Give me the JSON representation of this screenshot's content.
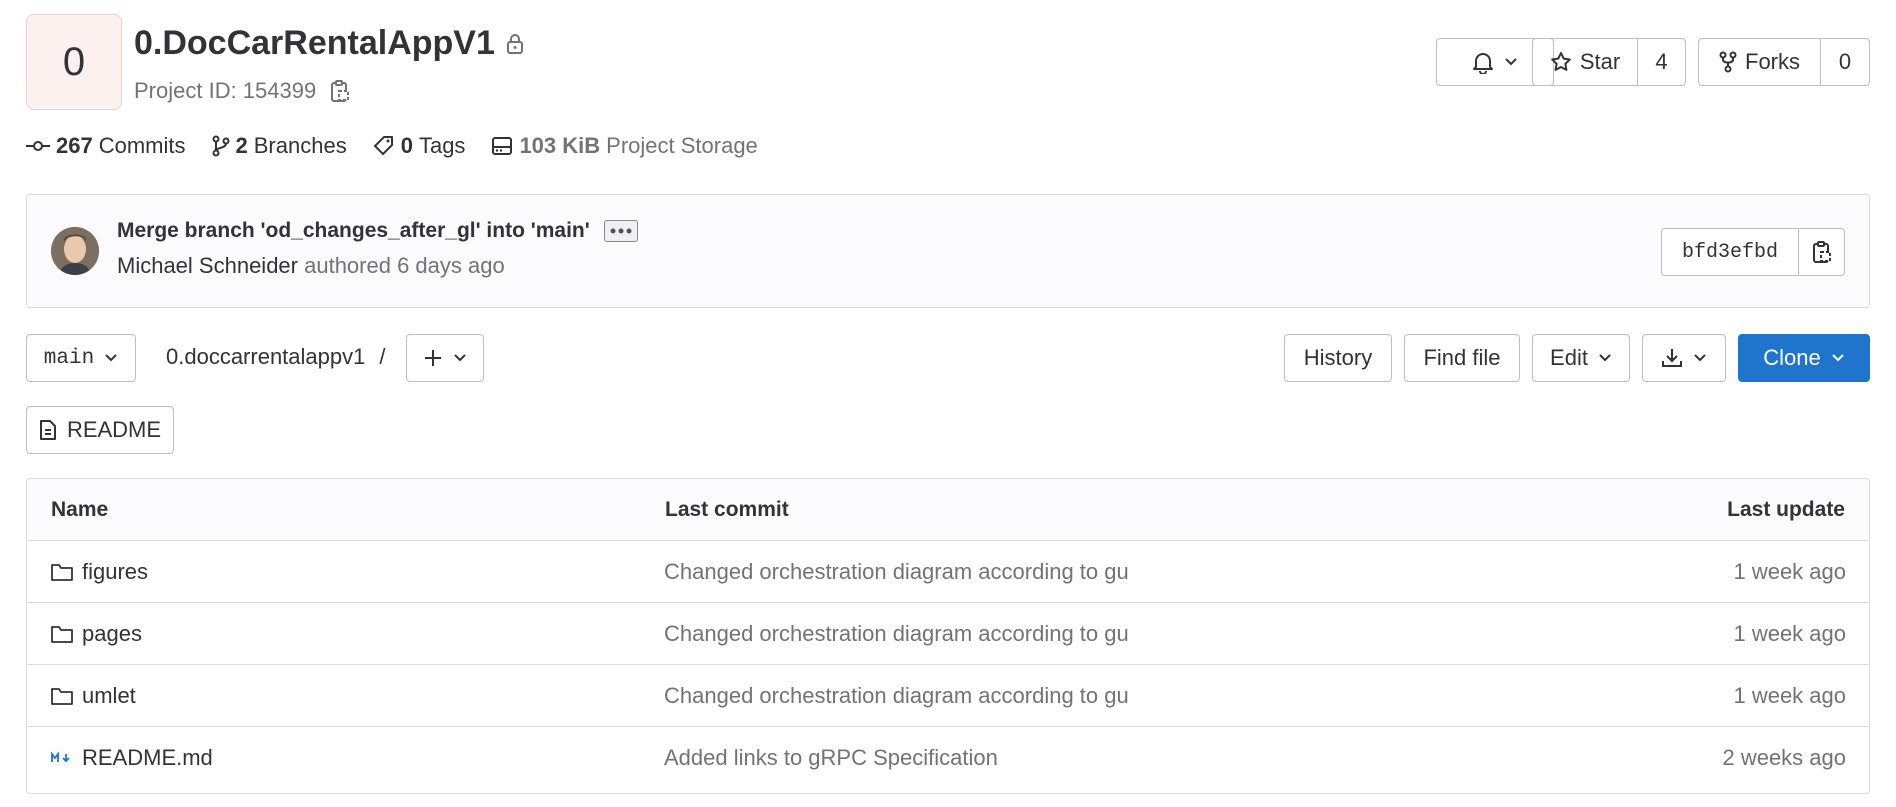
{
  "project": {
    "avatar_letter": "0",
    "name": "0.DocCarRentalAppV1",
    "id_label": "Project ID: 154399"
  },
  "actions": {
    "star_label": "Star",
    "star_count": "4",
    "forks_label": "Forks",
    "forks_count": "0"
  },
  "stats": {
    "commits_count": "267",
    "commits_label": "Commits",
    "branches_count": "2",
    "branches_label": "Branches",
    "tags_count": "0",
    "tags_label": "Tags",
    "storage_size": "103 KiB",
    "storage_label": "Project Storage"
  },
  "last_commit": {
    "message": "Merge branch 'od_changes_after_gl' into 'main'",
    "author": "Michael Schneider",
    "authored_text": "authored 6 days ago",
    "sha": "bfd3efbd"
  },
  "toolbar": {
    "branch": "main",
    "path": "0.doccarrentalappv1",
    "path_separator": "/",
    "history": "History",
    "find_file": "Find file",
    "edit": "Edit",
    "clone": "Clone"
  },
  "readme_button": "README",
  "table": {
    "headers": {
      "name": "Name",
      "last_commit": "Last commit",
      "last_update": "Last update"
    },
    "rows": [
      {
        "name": "figures",
        "icon": "folder-icon",
        "commit": "Changed orchestration diagram according to gu",
        "updated": "1 week ago"
      },
      {
        "name": "pages",
        "icon": "folder-icon",
        "commit": "Changed orchestration diagram according to gu",
        "updated": "1 week ago"
      },
      {
        "name": "umlet",
        "icon": "folder-icon",
        "commit": "Changed orchestration diagram according to gu",
        "updated": "1 week ago"
      },
      {
        "name": "README.md",
        "icon": "markdown-icon",
        "commit": "Added links to gRPC Specification",
        "updated": "2 weeks ago"
      }
    ]
  },
  "colors": {
    "accent": "#1f75cb",
    "avatar_bg": "#fcf1ef",
    "panel_bg": "#fbfafd",
    "border": "#dcdcde"
  }
}
